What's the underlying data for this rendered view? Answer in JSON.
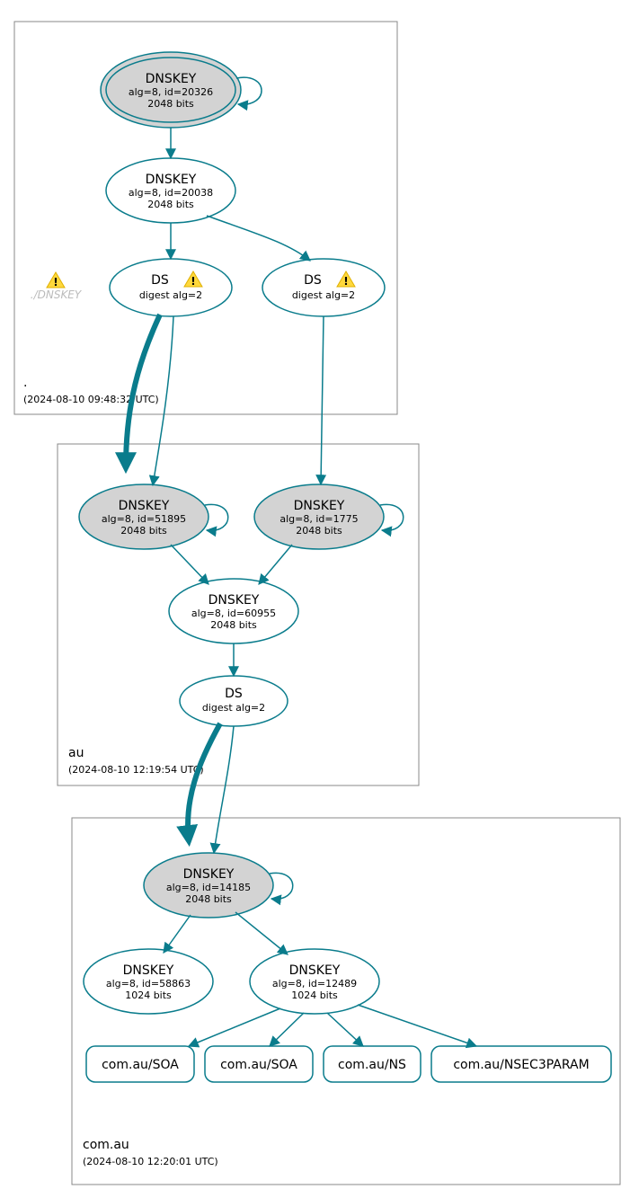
{
  "zones": {
    "root": {
      "label_prefix": ".",
      "timestamp": "(2024-08-10 09:48:32 UTC)",
      "faded_label": "./DNSKEY"
    },
    "au": {
      "label": "au",
      "timestamp": "(2024-08-10 12:19:54 UTC)"
    },
    "comau": {
      "label": "com.au",
      "timestamp": "(2024-08-10 12:20:01 UTC)"
    }
  },
  "nodes": {
    "root_ksk": {
      "title": "DNSKEY",
      "line2": "alg=8, id=20326",
      "line3": "2048 bits"
    },
    "root_zsk": {
      "title": "DNSKEY",
      "line2": "alg=8, id=20038",
      "line3": "2048 bits"
    },
    "root_ds1": {
      "title": "DS",
      "line2": "digest alg=2"
    },
    "root_ds2": {
      "title": "DS",
      "line2": "digest alg=2"
    },
    "au_ksk1": {
      "title": "DNSKEY",
      "line2": "alg=8, id=51895",
      "line3": "2048 bits"
    },
    "au_ksk2": {
      "title": "DNSKEY",
      "line2": "alg=8, id=1775",
      "line3": "2048 bits"
    },
    "au_zsk": {
      "title": "DNSKEY",
      "line2": "alg=8, id=60955",
      "line3": "2048 bits"
    },
    "au_ds": {
      "title": "DS",
      "line2": "digest alg=2"
    },
    "comau_ksk": {
      "title": "DNSKEY",
      "line2": "alg=8, id=14185",
      "line3": "2048 bits"
    },
    "comau_zsk1": {
      "title": "DNSKEY",
      "line2": "alg=8, id=58863",
      "line3": "1024 bits"
    },
    "comau_zsk2": {
      "title": "DNSKEY",
      "line2": "alg=8, id=12489",
      "line3": "1024 bits"
    },
    "rr_soa1": {
      "label": "com.au/SOA"
    },
    "rr_soa2": {
      "label": "com.au/SOA"
    },
    "rr_ns": {
      "label": "com.au/NS"
    },
    "rr_nsec3": {
      "label": "com.au/NSEC3PARAM"
    }
  }
}
